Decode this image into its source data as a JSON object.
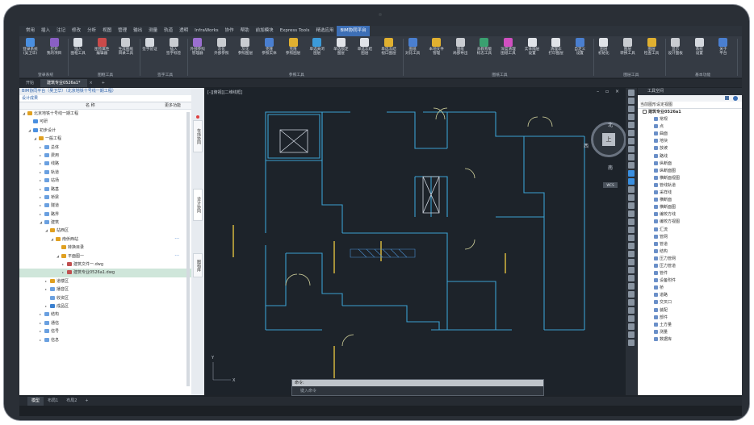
{
  "menubar": [
    "常用",
    "插入",
    "注记",
    "修改",
    "分析",
    "视图",
    "管理",
    "输出",
    "测量",
    "轨道",
    "透明",
    "InfraWorks",
    "协作",
    "帮助",
    "前加模块",
    "Express Tools",
    "精选应用",
    "BIM协同平台",
    ""
  ],
  "menubar_active_index": 17,
  "ribbon": {
    "buttons": [
      {
        "label": "登录系统\n(吴卫华)",
        "color": "#4a8fe0"
      },
      {
        "label": "打开\n我的项目",
        "color": "#8a5fc4"
      },
      {
        "label": "插入\n图框工具",
        "color": "#d9dde3"
      },
      {
        "label": "图签属性\n编辑器",
        "color": "#c94a4a"
      },
      {
        "label": "生成图纸\n目录工具",
        "color": "#c9ccd1"
      },
      {
        "label": "签字验证",
        "color": "#d4d8de"
      },
      {
        "label": "插入\n签字标签",
        "color": "#c9ccd1"
      },
      {
        "label": "外部参照\n管理器",
        "color": "#9b6fd0"
      },
      {
        "label": "灰化\n外部参照",
        "color": "#c9ccd1"
      },
      {
        "label": "灰化\n参照图层",
        "color": "#c9ccd1"
      },
      {
        "label": "克隆\n参照实体",
        "color": "#4a7fd0"
      },
      {
        "label": "克隆\n参照图层",
        "color": "#e0b030"
      },
      {
        "label": "单选关闭\n图层",
        "color": "#3c9ad8"
      },
      {
        "label": "单选锁定\n图层",
        "color": "#e0e3e8"
      },
      {
        "label": "单选冻结\n图层",
        "color": "#e0e3e8"
      },
      {
        "label": "单选冻结\n视口图层",
        "color": "#e0b030"
      },
      {
        "label": "图纸\n对比工具",
        "color": "#4a7fd0"
      },
      {
        "label": "本地文件\n管理",
        "color": "#e0b030"
      },
      {
        "label": "图纸\n局部导出",
        "color": "#c9ccd1"
      },
      {
        "label": "去教育版\n标志工具",
        "color": "#3aa070"
      },
      {
        "label": "深度清理\n图纸工具",
        "color": "#d050c0"
      },
      {
        "label": "实体隔层\n设置",
        "color": "#e0e3e8"
      },
      {
        "label": "清理非\n打印图层",
        "color": "#e0e3e8"
      },
      {
        "label": "自定义\n设置",
        "color": "#4a7fd0"
      },
      {
        "label": "图层\n初始化",
        "color": "#e0e3e8"
      },
      {
        "label": "图层\n转换工具",
        "color": "#c9ccd1"
      },
      {
        "label": "图层\n检查工具",
        "color": "#e0b030"
      },
      {
        "label": "显示\n设计面板",
        "color": "#c9ccd1"
      },
      {
        "label": "系统\n设置",
        "color": "#d4d8de"
      },
      {
        "label": "关于\n平台",
        "color": "#4a7fd0"
      }
    ],
    "groups": [
      "登录系统",
      "图框工具",
      "签字工具",
      "参照工具",
      "图纸工具",
      "图层工具",
      "基本功能"
    ]
  },
  "doc_tabs": [
    "开始",
    "建筑专业0526a1*",
    "+"
  ],
  "doc_tabs_close": "×",
  "left_panel": {
    "title": "BIM协同平台（吴卫华）（北京地铁十号线一期工程）",
    "tab": "设计成果",
    "col_name": "名 称",
    "col_more": "更多功能",
    "rows": [
      {
        "label": "北京地铁十号线一期工程",
        "indent": 0,
        "arrow": "◢",
        "color": "#e0a020"
      },
      {
        "label": "可研",
        "indent": 1,
        "arrow": "",
        "color": "#4a8fe0"
      },
      {
        "label": "初步设计",
        "indent": 1,
        "arrow": "◢",
        "color": "#4a8fe0"
      },
      {
        "label": "一般工程",
        "indent": 2,
        "arrow": "◢",
        "color": "#e0a020"
      },
      {
        "label": "总体",
        "indent": 3,
        "arrow": "▸",
        "color": "#6aa0e0"
      },
      {
        "label": "费用",
        "indent": 3,
        "arrow": "▸",
        "color": "#6aa0e0"
      },
      {
        "label": "线路",
        "indent": 3,
        "arrow": "▸",
        "color": "#6aa0e0"
      },
      {
        "label": "轨道",
        "indent": 3,
        "arrow": "▸",
        "color": "#6aa0e0"
      },
      {
        "label": "站场",
        "indent": 3,
        "arrow": "▸",
        "color": "#6aa0e0"
      },
      {
        "label": "路基",
        "indent": 3,
        "arrow": "▸",
        "color": "#6aa0e0"
      },
      {
        "label": "桥梁",
        "indent": 3,
        "arrow": "▸",
        "color": "#6aa0e0"
      },
      {
        "label": "隧道",
        "indent": 3,
        "arrow": "▸",
        "color": "#6aa0e0"
      },
      {
        "label": "路界",
        "indent": 3,
        "arrow": "▸",
        "color": "#6aa0e0"
      },
      {
        "label": "建筑",
        "indent": 3,
        "arrow": "◢",
        "color": "#6aa0e0"
      },
      {
        "label": "站西区",
        "indent": 4,
        "arrow": "◢",
        "color": "#e0a020"
      },
      {
        "label": "南侨西站",
        "indent": 5,
        "arrow": "◢",
        "color": "#e0a020",
        "dots": "···"
      },
      {
        "label": "转换目录",
        "indent": 6,
        "arrow": "",
        "color": "#e0a020"
      },
      {
        "label": "平面图一",
        "indent": 6,
        "arrow": "◢",
        "color": "#e0a020",
        "dots": "···"
      },
      {
        "label": "建筑文件一.dwg",
        "indent": 7,
        "arrow": "▸",
        "color": "#c05050"
      },
      {
        "label": "建筑专业0526a1.dwg",
        "indent": 7,
        "arrow": "▸",
        "color": "#c05050",
        "selected": true
      },
      {
        "label": "道楼区",
        "indent": 4,
        "arrow": "▸",
        "color": "#e0a020"
      },
      {
        "label": "播音区",
        "indent": 4,
        "arrow": "▸",
        "color": "#6aa0e0"
      },
      {
        "label": "收资区",
        "indent": 4,
        "arrow": "",
        "color": "#6aa0e0"
      },
      {
        "label": "成品区",
        "indent": 4,
        "arrow": "▸",
        "color": "#3a80d0"
      },
      {
        "label": "结构",
        "indent": 3,
        "arrow": "▸",
        "color": "#6aa0e0"
      },
      {
        "label": "通信",
        "indent": 3,
        "arrow": "▸",
        "color": "#6aa0e0"
      },
      {
        "label": "信号",
        "indent": 3,
        "arrow": "▸",
        "color": "#6aa0e0"
      },
      {
        "label": "信息",
        "indent": 3,
        "arrow": "▸",
        "color": "#6aa0e0"
      }
    ]
  },
  "vtabs": [
    "在线协同",
    "设计协同",
    "图档库"
  ],
  "canvas": {
    "title": "[-][俯视][二维线框]",
    "controls": "– ▫ ×",
    "compass": {
      "n": "北",
      "s": "南",
      "w": "西",
      "e": "东",
      "center": "上",
      "wcs": "WCS"
    },
    "axis_x": "X",
    "axis_y": "Y"
  },
  "right_panel": {
    "title": "工具空间",
    "search": "当前图形设定视图",
    "root": "建筑专业0526a1",
    "items": [
      "常规",
      "点",
      "曲面",
      "地块",
      "放坡",
      "路线",
      "纵断面",
      "纵断面图",
      "横断面视图",
      "管线轨道",
      "采样线",
      "横断面",
      "横断面图",
      "编校方线",
      "编校方视图",
      "汇流",
      "管网",
      "管道",
      "结构",
      "压力管网",
      "压力管道",
      "管件",
      "设备附件",
      "桥",
      "道路",
      "交叉口",
      "装配",
      "部件",
      "土方量",
      "测量",
      "数据库"
    ],
    "side_tabs": [
      "浏览",
      "设置",
      "测量",
      "工具箱"
    ]
  },
  "command": {
    "header": "命令:",
    "placeholder": "键入命令"
  },
  "bottom_tabs": [
    "模型",
    "布局1",
    "布局2",
    "+"
  ]
}
